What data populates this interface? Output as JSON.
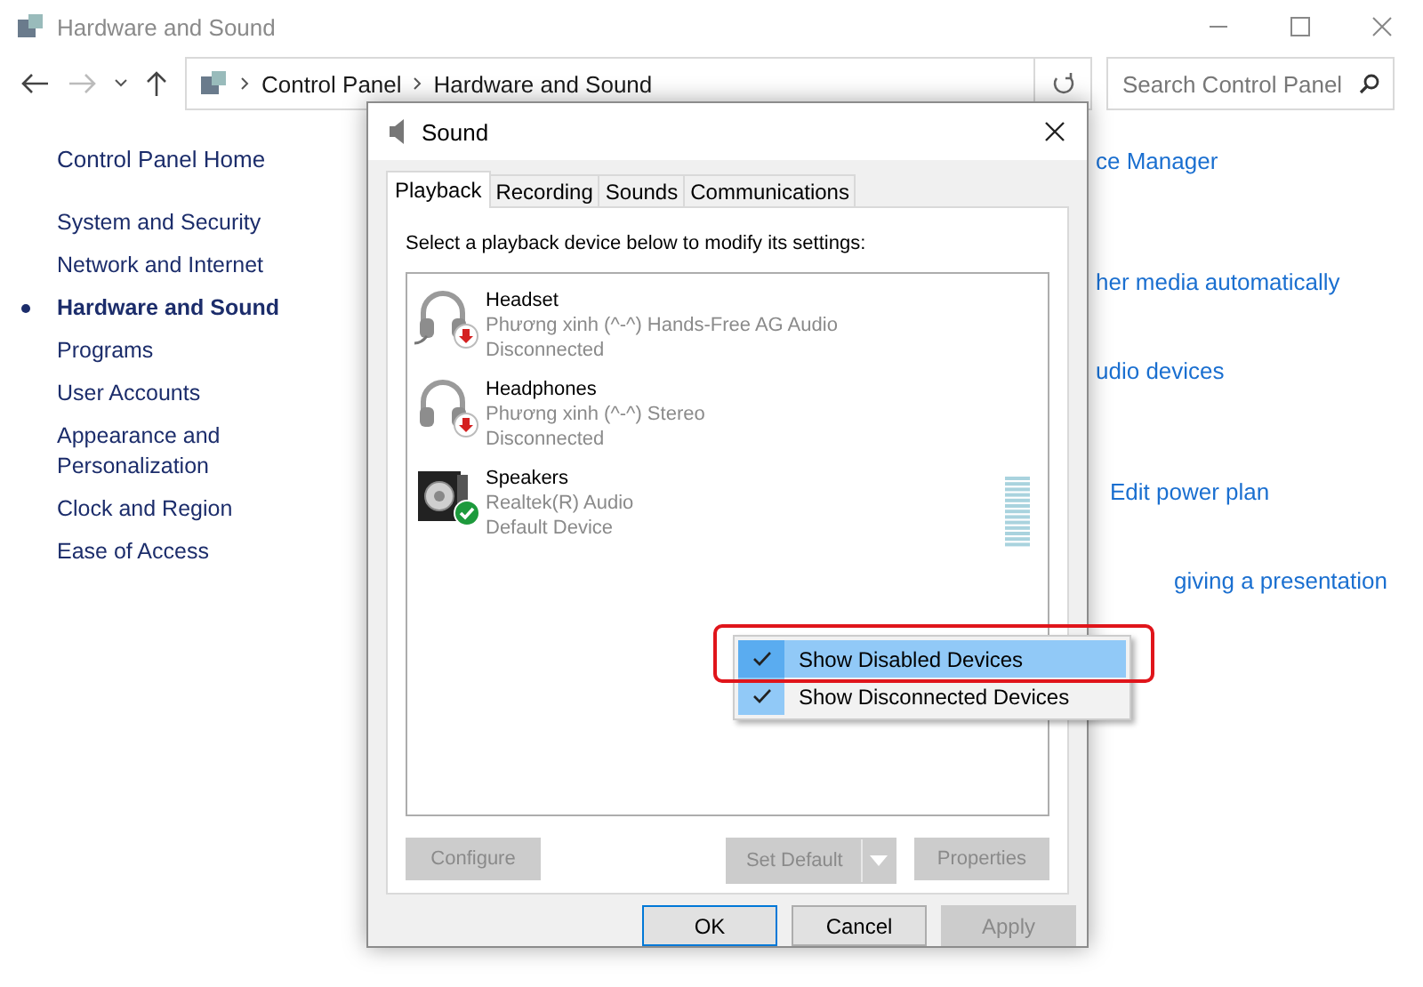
{
  "window": {
    "title": "Hardware and Sound"
  },
  "nav": {
    "breadcrumb": [
      "Control Panel",
      "Hardware and Sound"
    ],
    "search": {
      "placeholder": "Search Control Panel"
    }
  },
  "sidebar": {
    "home": "Control Panel Home",
    "items": [
      {
        "label": "System and Security",
        "selected": false
      },
      {
        "label": "Network and Internet",
        "selected": false
      },
      {
        "label": "Hardware and Sound",
        "selected": true
      },
      {
        "label": "Programs",
        "selected": false
      },
      {
        "label": "User Accounts",
        "selected": false
      },
      {
        "label": "Appearance and Personalization",
        "selected": false
      },
      {
        "label": "Clock and Region",
        "selected": false
      },
      {
        "label": "Ease of Access",
        "selected": false
      }
    ]
  },
  "content_links": [
    "ce Manager",
    "her media automatically",
    "udio devices",
    "Edit power plan",
    "giving a presentation"
  ],
  "dialog": {
    "title": "Sound",
    "tabs": [
      {
        "label": "Playback",
        "selected": true
      },
      {
        "label": "Recording",
        "selected": false
      },
      {
        "label": "Sounds",
        "selected": false
      },
      {
        "label": "Communications",
        "selected": false
      }
    ],
    "instruction": "Select a playback device below to modify its settings:",
    "devices": [
      {
        "name": "Headset",
        "description": "Phương xinh (^-^) Hands-Free AG Audio",
        "status": "Disconnected",
        "kind": "headset",
        "connected": false
      },
      {
        "name": "Headphones",
        "description": "Phương xinh (^-^) Stereo",
        "status": "Disconnected",
        "kind": "headphones",
        "connected": false
      },
      {
        "name": "Speakers",
        "description": "Realtek(R) Audio",
        "status": "Default Device",
        "kind": "speaker",
        "connected": true
      }
    ],
    "buttons": [
      {
        "label": "Configure",
        "disabled": true,
        "kind": "plain"
      },
      {
        "label": "Set Default",
        "disabled": true,
        "kind": "split"
      },
      {
        "label": "Properties",
        "disabled": true,
        "kind": "plain"
      }
    ],
    "footer_buttons": [
      {
        "label": "OK",
        "disabled": false,
        "default": true
      },
      {
        "label": "Cancel",
        "disabled": false,
        "default": false
      },
      {
        "label": "Apply",
        "disabled": true,
        "default": false
      }
    ]
  },
  "context_menu": {
    "items": [
      {
        "label": "Show Disabled Devices",
        "checked": true,
        "selected": true,
        "outlined": true
      },
      {
        "label": "Show Disconnected Devices",
        "checked": true,
        "selected": false,
        "outlined": false
      }
    ]
  }
}
